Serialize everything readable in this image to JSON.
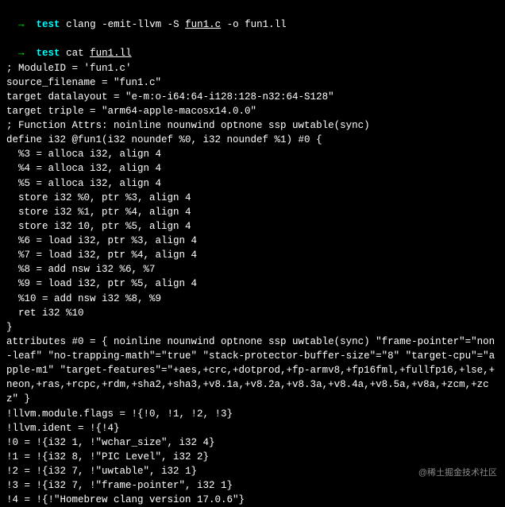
{
  "prompt1": {
    "arrow": "→",
    "dir": "test",
    "cmd_prefix": "clang -emit-llvm -S ",
    "cmd_file": "fun1.c",
    "cmd_suffix": " -o fun1.ll"
  },
  "prompt2": {
    "arrow": "→",
    "dir": "test",
    "cmd_prefix": "cat ",
    "cmd_file": "fun1.ll"
  },
  "output": {
    "l01": "; ModuleID = 'fun1.c'",
    "l02": "source_filename = \"fun1.c\"",
    "l03": "target datalayout = \"e-m:o-i64:64-i128:128-n32:64-S128\"",
    "l04": "target triple = \"arm64-apple-macosx14.0.0\"",
    "l05": "",
    "l06": "; Function Attrs: noinline nounwind optnone ssp uwtable(sync)",
    "l07": "define i32 @fun1(i32 noundef %0, i32 noundef %1) #0 {",
    "l08": "  %3 = alloca i32, align 4",
    "l09": "  %4 = alloca i32, align 4",
    "l10": "  %5 = alloca i32, align 4",
    "l11": "  store i32 %0, ptr %3, align 4",
    "l12": "  store i32 %1, ptr %4, align 4",
    "l13": "  store i32 10, ptr %5, align 4",
    "l14": "  %6 = load i32, ptr %3, align 4",
    "l15": "  %7 = load i32, ptr %4, align 4",
    "l16": "  %8 = add nsw i32 %6, %7",
    "l17": "  %9 = load i32, ptr %5, align 4",
    "l18": "  %10 = add nsw i32 %8, %9",
    "l19": "  ret i32 %10",
    "l20": "}",
    "l21": "",
    "l22": "attributes #0 = { noinline nounwind optnone ssp uwtable(sync) \"frame-pointer\"=\"non-leaf\" \"no-trapping-math\"=\"true\" \"stack-protector-buffer-size\"=\"8\" \"target-cpu\"=\"apple-m1\" \"target-features\"=\"+aes,+crc,+dotprod,+fp-armv8,+fp16fml,+fullfp16,+lse,+neon,+ras,+rcpc,+rdm,+sha2,+sha3,+v8.1a,+v8.2a,+v8.3a,+v8.4a,+v8.5a,+v8a,+zcm,+zcz\" }",
    "l23": "",
    "l24": "!llvm.module.flags = !{!0, !1, !2, !3}",
    "l25": "!llvm.ident = !{!4}",
    "l26": "",
    "l27": "!0 = !{i32 1, !\"wchar_size\", i32 4}",
    "l28": "!1 = !{i32 8, !\"PIC Level\", i32 2}",
    "l29": "!2 = !{i32 7, !\"uwtable\", i32 1}",
    "l30": "!3 = !{i32 7, !\"frame-pointer\", i32 1}",
    "l31": "!4 = !{!\"Homebrew clang version 17.0.6\"}"
  },
  "watermark": "@稀土掘金技术社区"
}
